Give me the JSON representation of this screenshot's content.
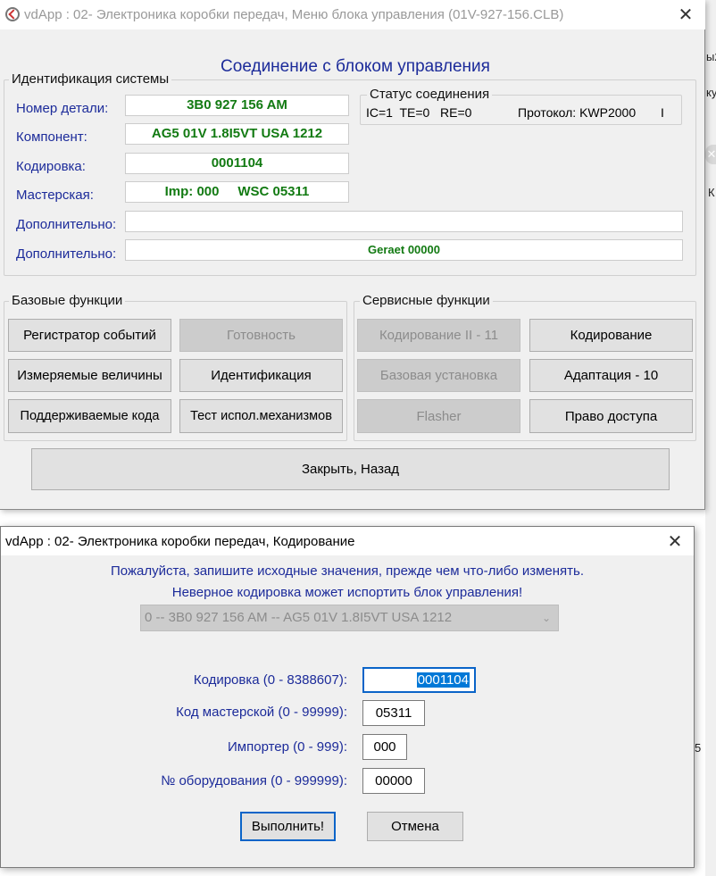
{
  "background": {
    "fragments": [
      "ы2",
      "ку",
      "К",
      "5"
    ],
    "close_glyph": "✕"
  },
  "window1": {
    "title": "vdApp : 02- Электроника коробки передач,  Меню блока управления (01V-927-156.CLB)",
    "close_glyph": "✕",
    "heading": "Соединение с блоком управления",
    "system_id": {
      "legend": "Идентификация системы",
      "part_number_label": "Номер детали:",
      "part_number": "3B0 927 156 AM",
      "component_label": "Компонент:",
      "component": "AG5 01V 1.8I5VT USA 1212",
      "coding_label": "Кодировка:",
      "coding": "0001104",
      "workshop_label": "Мастерская:",
      "workshop": "Imp: 000     WSC 05311",
      "extra1_label": "Дополнительно:",
      "extra1": "",
      "extra2_label": "Дополнительно:",
      "extra2": "Geraet 00000"
    },
    "status": {
      "legend": "Статус соединения",
      "counters": "IC=1  TE=0   RE=0",
      "protocol": "Протокол: KWP2000",
      "indicator": "I"
    },
    "basic": {
      "legend": "Базовые функции",
      "fault_codes": "Регистратор событий",
      "readiness": "Готовность",
      "measured": "Измеряемые величины",
      "identification": "Идентификация",
      "supported_codes": "Поддерживаемые кода",
      "output_test": "Тест испол.механизмов"
    },
    "service": {
      "legend": "Сервисные функции",
      "coding2": "Кодирование II - 11",
      "coding": "Кодирование",
      "basic_settings": "Базовая установка",
      "adaptation": "Адаптация - 10",
      "flasher": "Flasher",
      "access": "Право доступа"
    },
    "close_back": "Закрыть, Назад"
  },
  "window2": {
    "title": "vdApp : 02- Электроника коробки передач,  Кодирование",
    "close_glyph": "✕",
    "warning_line1": "Пожалуйста, запишите исходные значения, прежде чем что-либо изменять.",
    "warning_line2": "Неверное кодировка может испортить блок управления!",
    "module_select": "0 -- 3B0 927 156 AM -- AG5 01V 1.8I5VT USA 1212",
    "coding_label": "Кодировка (0 - 8388607):",
    "coding_value": "0001104",
    "workshop_label": "Код мастерской (0 - 99999):",
    "workshop_value": "05311",
    "importer_label": "Импортер (0 - 999):",
    "importer_value": "000",
    "equipment_label": "№ оборудования (0 - 999999):",
    "equipment_value": "00000",
    "execute": "Выполнить!",
    "cancel": "Отмена"
  }
}
